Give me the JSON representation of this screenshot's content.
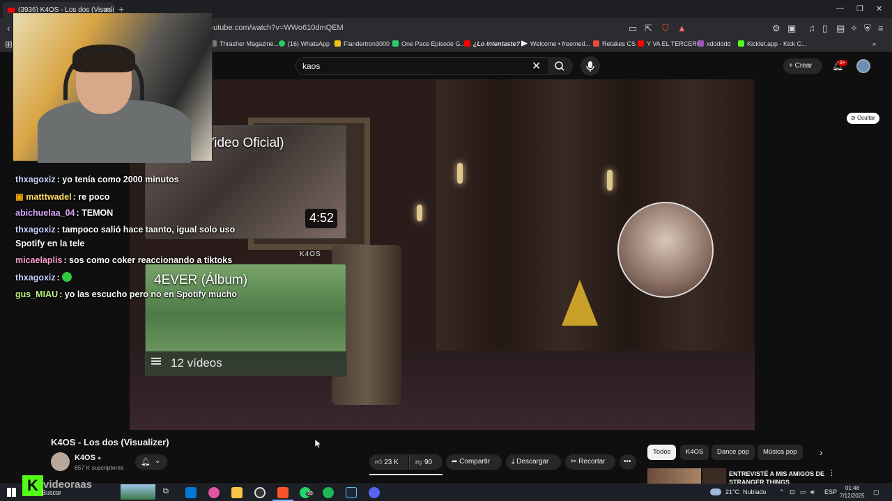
{
  "browser": {
    "tab_title": "(3936) K4OS - Los dos (Visualizer)",
    "url": "outube.com/watch?v=WWo610dmQEM",
    "bookmarks": [
      "Thrasher Magazine...",
      "(16) WhatsApp",
      "Flandertron3000",
      "One Pace Episode G...",
      "¿Lo intentaste?",
      "Welcome • freemed...",
      "Retakes CS",
      "Y VA EL TERCERO",
      "xdddddd",
      "Kicklet.app - Kick C..."
    ],
    "bookmark_colors": [
      "#777777",
      "#25d366",
      "#f1c40f",
      "#2ecc71",
      "#ff0000",
      "#ffffff",
      "#e74c3c",
      "#ff0000",
      "#9b59b6",
      "#53fc18"
    ]
  },
  "youtube": {
    "search_value": "kaos",
    "create_label": "Crear",
    "notif_count": "9+",
    "hide_label": "Ocultar"
  },
  "endscreen": {
    "video_title": "4EVER (Video Oficial)",
    "video_duration": "4:52",
    "playlist_title": "4EVER (Álbum)",
    "playlist_count": "12 vídeos",
    "logo_text": "K4OS"
  },
  "chat": [
    {
      "user": "thxagoxiz",
      "color": "#c7d3ff",
      "text": ": yo tenía como 2000 minutos"
    },
    {
      "user": "matttwadel",
      "color": "#ffe066",
      "text": ": re poco"
    },
    {
      "user": "abichuelaa_04",
      "color": "#d9a8ff",
      "text": ": TEMON"
    },
    {
      "user": "thxagoxiz",
      "color": "#c7d3ff",
      "text": ": tampoco salió hace taanto, igual solo uso"
    },
    {
      "user": "",
      "color": "#ffffff",
      "text": "Spotify en la tele"
    },
    {
      "user": "micaelaplis",
      "color": "#ff9ccf",
      "text": ": sos como coker reaccionando a tiktoks"
    },
    {
      "user": "thxagoxiz",
      "color": "#c7d3ff",
      "text": ":"
    },
    {
      "user": "gus_MIAU",
      "color": "#b9f27c",
      "text": ": yo las escucho pero no en Spotify mucho"
    }
  ],
  "video": {
    "title": "K4OS - Los dos (Visualizer)",
    "channel": "K4OS",
    "subscribers": "857 K suscriptores",
    "likes": "23 K",
    "dislikes": "90",
    "share": "Compartir",
    "download": "Descargar",
    "clip": "Recortar"
  },
  "chips": [
    "Todos",
    "K4OS",
    "Dance pop",
    "Música pop"
  ],
  "recommended": {
    "title": "ENTREVISTÉ A MIS AMIGOS DE STRANGER THINGS"
  },
  "taskbar": {
    "search_label": "Buscar",
    "weather": "21°C",
    "weather_desc": "Nublado",
    "lang": "ESP",
    "time": "01:48",
    "date": "7/12/2025",
    "whatsapp_badge": "99",
    "overlay_text": "videoraas"
  }
}
